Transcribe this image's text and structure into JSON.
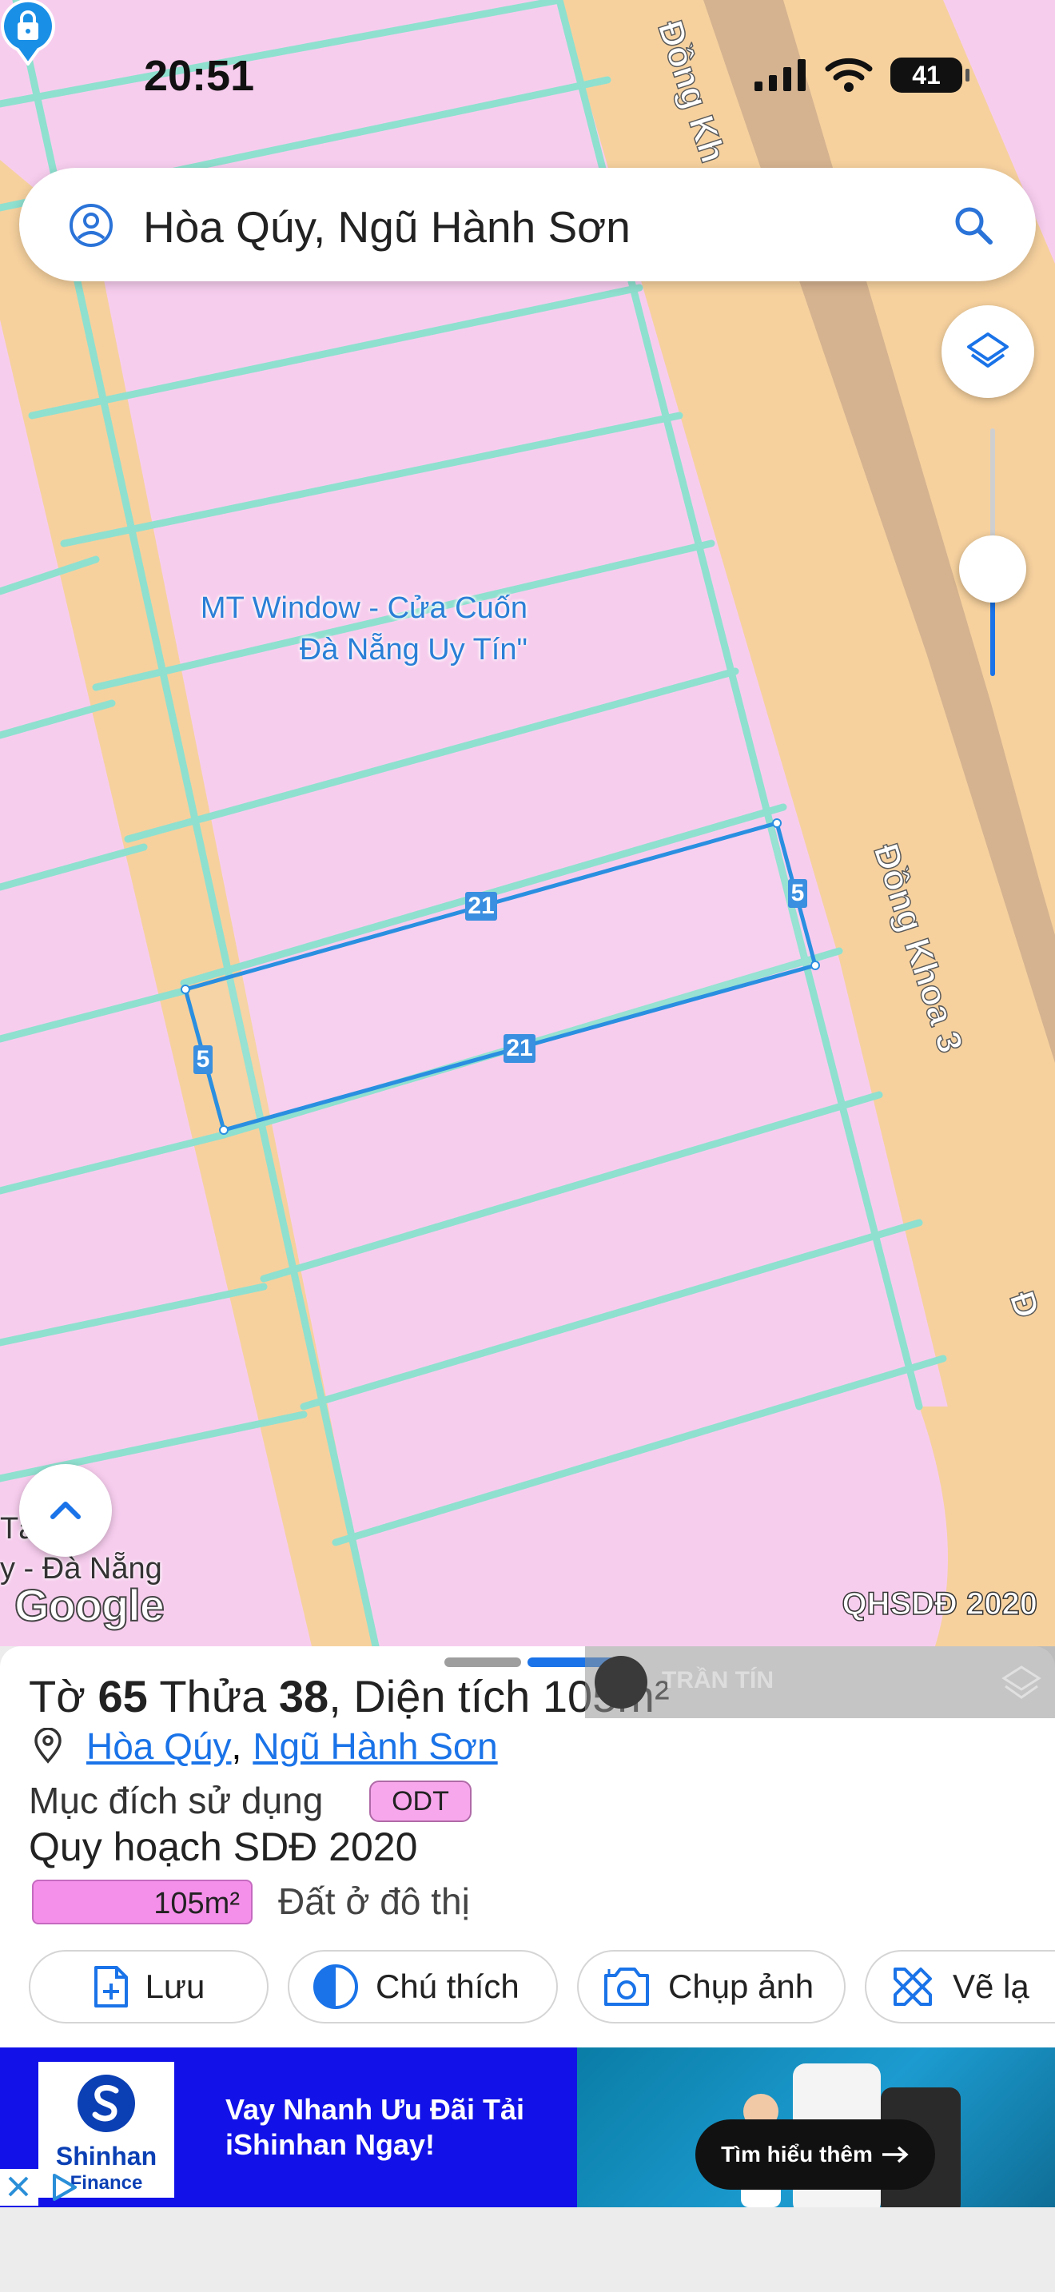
{
  "status_bar": {
    "time": "20:51",
    "battery": "41"
  },
  "search": {
    "text": "Hòa Qúy, Ngũ Hành Sơn"
  },
  "map": {
    "poi_label": "MT Window - Cửa Cuốn Đà Nẵng Uy Tín\"",
    "road_label_top": "Đồng Kh",
    "road_label_main": "Đồng Khoa 3",
    "road_label_edge": "Đ",
    "left_label_line1": "Tâ     ong",
    "left_label_line2": "y - Đà Nẵng",
    "google": "Google",
    "layer_badge": "QHSDĐ 2020",
    "dimensions": {
      "top": "21",
      "bottom": "21",
      "left": "5",
      "right": "5"
    }
  },
  "watermark": {
    "name": "TRẦN TÍN"
  },
  "parcel": {
    "to_label": "Tờ",
    "to_value": "65",
    "thua_label": "Thửa",
    "thua_value": "38",
    "area_label": ", Diện tích",
    "area_value": "105m²",
    "ward": "Hòa Qúy",
    "separator": ",",
    "district": "Ngũ Hành Sơn",
    "purpose_label": "Mục đích sử dụng",
    "purpose_code": "ODT",
    "plan_title": "Quy hoạch SDĐ 2020",
    "legend_area": "105m²",
    "legend_desc": "Đất ở đô thị",
    "zone_color": "#f590ea"
  },
  "actions": [
    {
      "label": "Lưu",
      "icon": "save-file-icon"
    },
    {
      "label": "Chú thích",
      "icon": "contrast-icon"
    },
    {
      "label": "Chụp ảnh",
      "icon": "camera-icon"
    },
    {
      "label": "Vẽ lạ",
      "icon": "draw-icon"
    }
  ],
  "ad": {
    "brand_top": "Shinhan",
    "brand_bottom": "Finance",
    "headline_line1": "Vay Nhanh Ưu Đãi Tải",
    "headline_line2": "iShinhan Ngay!",
    "cta": "Tìm hiểu thêm",
    "accent": "#1212e8"
  }
}
